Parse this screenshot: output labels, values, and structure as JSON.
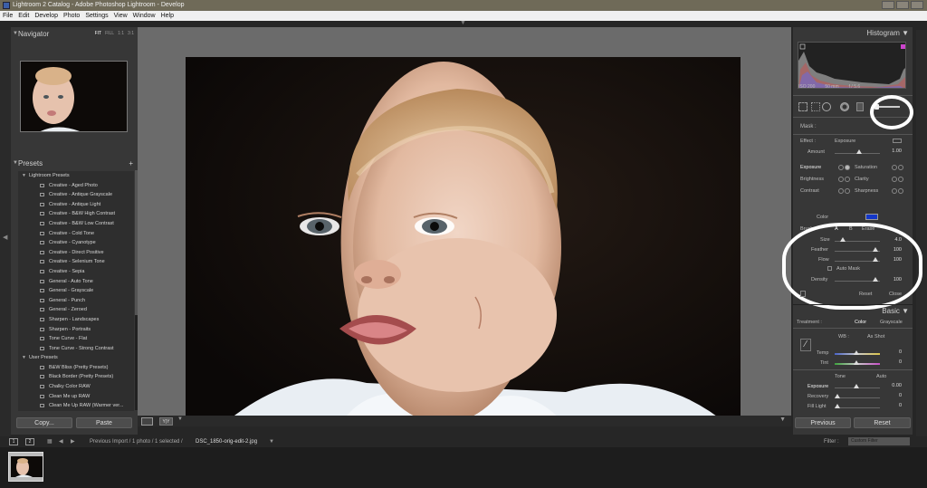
{
  "window": {
    "title": "Lightroom 2 Catalog - Adobe Photoshop Lightroom - Develop"
  },
  "menu": [
    "File",
    "Edit",
    "Develop",
    "Photo",
    "Settings",
    "View",
    "Window",
    "Help"
  ],
  "left": {
    "navigator_title": "Navigator",
    "nav_options": [
      "FIT",
      "FILL",
      "1:1",
      "3:1"
    ],
    "presets_title": "Presets",
    "groups": [
      {
        "label": "Lightroom Presets",
        "items": [
          "Creative - Aged Photo",
          "Creative - Antique Grayscale",
          "Creative - Antique Light",
          "Creative - B&W High Contrast",
          "Creative - B&W Low Contrast",
          "Creative - Cold Tone",
          "Creative - Cyanotype",
          "Creative - Direct Positive",
          "Creative - Selenium Tone",
          "Creative - Sepia",
          "General - Auto Tone",
          "General - Grayscale",
          "General - Punch",
          "General - Zeroed",
          "Sharpen - Landscapes",
          "Sharpen - Portraits",
          "Tone Curve - Flat",
          "Tone Curve - Strong Contrast"
        ]
      },
      {
        "label": "User Presets",
        "items": [
          "B&W Bliss (Pretty Presets)",
          "Black Border (Pretty Presets)",
          "Chalky Color RAW",
          "Clean Me up RAW",
          "Clean Me Up RAW (Warmer ver..."
        ]
      }
    ],
    "copy_label": "Copy...",
    "paste_label": "Paste"
  },
  "right": {
    "histogram_title": "Histogram",
    "hist_info": [
      "ISO 200",
      "50 mm",
      "f / 5.6"
    ],
    "mask_label": "Mask :",
    "effect_label": "Effect :",
    "effect_value": "Exposure",
    "amount_label": "Amount",
    "amount_value": "1.00",
    "toggles_left": [
      "Exposure",
      "Brightness",
      "Contrast"
    ],
    "toggles_right": [
      "Saturation",
      "Clarity",
      "Sharpness"
    ],
    "color_label": "Color",
    "colors": {
      "swatch": "#1437c8"
    },
    "brush_label": "Brush :",
    "brush_a": "A",
    "brush_b": "B",
    "brush_erase": "Erase",
    "size_label": "Size",
    "size_value": "4.0",
    "feather_label": "Feather",
    "feather_value": "100",
    "flow_label": "Flow",
    "flow_value": "100",
    "automask_label": "Auto Mask",
    "density_label": "Density",
    "density_value": "100",
    "reset_label": "Reset",
    "close_label": "Close",
    "basic_title": "Basic",
    "treatment_label": "Treatment :",
    "treatment_color": "Color",
    "treatment_gray": "Grayscale",
    "wb_label": "WB :",
    "wb_value": "As Shot",
    "temp_label": "Temp",
    "temp_value": "0",
    "tint_label": "Tint",
    "tint_value": "0",
    "tone_label": "Tone",
    "auto_label": "Auto",
    "exposure_label": "Exposure",
    "exposure_value": "0.00",
    "recovery_label": "Recovery",
    "recovery_value": "0",
    "filllight_label": "Fill Light",
    "filllight_value": "0",
    "previous_label": "Previous",
    "reset_btn_label": "Reset"
  },
  "filmbar": {
    "page1": "1",
    "page2": "2",
    "path": "Previous Import / 1 photo / 1 selected /",
    "filename": "DSC_1850-orig-edit-2.jpg",
    "filter_label": "Filter :",
    "filter_value": "Custom Filter"
  }
}
